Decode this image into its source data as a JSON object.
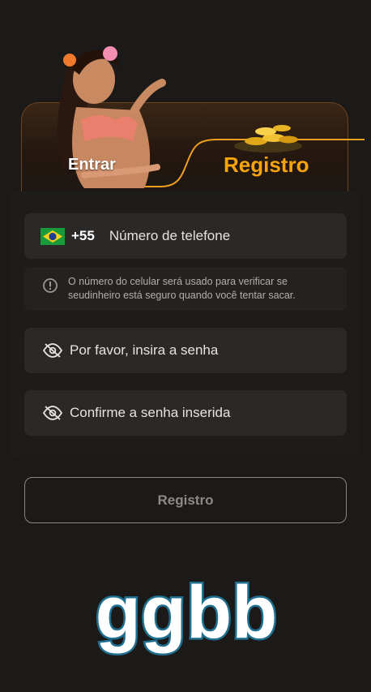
{
  "tabs": {
    "login_label": "Entrar",
    "register_label": "Registro"
  },
  "phone": {
    "country_code": "+55",
    "placeholder": "Número de telefone",
    "flag_icon": "brazil-flag-icon"
  },
  "notice": {
    "text": "O número do celular será usado para verificar se seudinheiro está seguro quando você tentar sacar.",
    "icon": "info-icon"
  },
  "password": {
    "placeholder": "Por favor, insira a senha",
    "icon": "eye-off-icon"
  },
  "confirm_password": {
    "placeholder": "Confirme a senha inserida",
    "icon": "eye-off-icon"
  },
  "submit": {
    "label": "Registro"
  },
  "brand": {
    "logo_text": "ggbb"
  },
  "colors": {
    "accent": "#f5a40e",
    "background": "#1b1a19",
    "field": "#2b2927",
    "logo_fill": "#ffffff",
    "logo_stroke": "#1f6f8f"
  }
}
